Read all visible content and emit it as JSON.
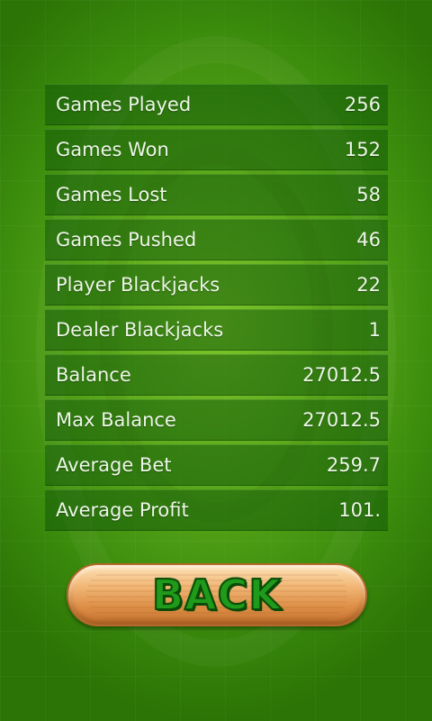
{
  "stats": [
    {
      "label": "Games Played",
      "value": "256"
    },
    {
      "label": "Games Won",
      "value": "152"
    },
    {
      "label": "Games Lost",
      "value": "58"
    },
    {
      "label": "Games Pushed",
      "value": "46"
    },
    {
      "label": "Player Blackjacks",
      "value": "22"
    },
    {
      "label": "Dealer Blackjacks",
      "value": "1"
    },
    {
      "label": "Balance",
      "value": "27012.5"
    },
    {
      "label": "Max Balance",
      "value": "27012.5"
    },
    {
      "label": "Average Bet",
      "value": "259.7"
    },
    {
      "label": "Average Profit",
      "value": "101."
    }
  ],
  "back_button": {
    "label": "BACK"
  },
  "colors": {
    "table_green": "#5aa81a",
    "row_background": "#145a0a",
    "button_wood": "#f2b878",
    "button_text": "#1f9a1a"
  }
}
